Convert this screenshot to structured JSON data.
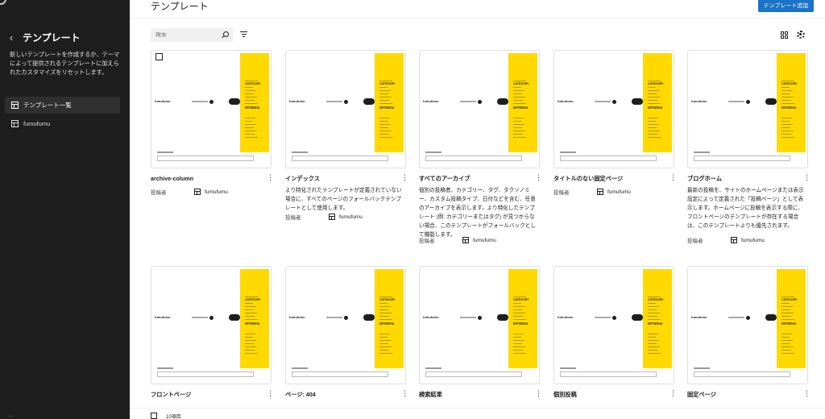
{
  "sidebar": {
    "back_label": "‹",
    "title": "テンプレート",
    "description": "新しいテンプレートを作成するか、テーマによって提供されるテンプレートに加えられたカスタマイズをリセットします。",
    "items": [
      {
        "label": "テンプレート一覧",
        "active": true
      },
      {
        "label": "fumufumu",
        "active": false
      }
    ],
    "footer_label": "…"
  },
  "header": {
    "title": "テンプレート",
    "add_button": "テンプレート追加"
  },
  "search": {
    "placeholder": "検索"
  },
  "colors": {
    "accent": "#1a73c7",
    "sidebar_bg": "#1e1e1e",
    "thumb_yellow": "#ffd900"
  },
  "thumbnail": {
    "logo": "fumufumu",
    "category_heading": "CATEGORY",
    "keyword_heading": "KEYWORD"
  },
  "cards": [
    {
      "title": "archive-column",
      "description": "",
      "author_label": "投稿者",
      "author": "fumufumu"
    },
    {
      "title": "インデックス",
      "description": "より特化されたテンプレートが定義されていない場合に、すべてのページのフォールバックテンプレートとして使用します。",
      "author_label": "投稿者",
      "author": "fumufumu"
    },
    {
      "title": "すべてのアーカイブ",
      "description": "個別の投稿者、カテゴリー、タグ、タクソノミー、カスタム投稿タイプ、日付などを含む、任意のアーカイブを表示します。より特化したテンプレート (例: カテゴリーまたはタグ) が見つからない場合、このテンプレートがフォールバックとして機能します。",
      "author_label": "投稿者",
      "author": "fumufumu"
    },
    {
      "title": "タイトルのない固定ページ",
      "description": "",
      "author_label": "投稿者",
      "author": "fumufumu"
    },
    {
      "title": "ブログホーム",
      "description": "最新の投稿を、サイトのホームページまたは表示設定によって定義された「投稿ページ」として表示します。ホームページに投稿を表示する際に、フロントページのテンプレートが存在する場合は、このテンプレートよりも優先されます。",
      "author_label": "投稿者",
      "author": "fumufumu"
    },
    {
      "title": "フロントページ",
      "description": "",
      "author_label": "",
      "author": ""
    },
    {
      "title": "ページ: 404",
      "description": "",
      "author_label": "",
      "author": ""
    },
    {
      "title": "検索結果",
      "description": "",
      "author_label": "",
      "author": ""
    },
    {
      "title": "個別投稿",
      "description": "",
      "author_label": "",
      "author": ""
    },
    {
      "title": "固定ページ",
      "description": "",
      "author_label": "",
      "author": ""
    }
  ],
  "footer": {
    "count": "10項目"
  }
}
